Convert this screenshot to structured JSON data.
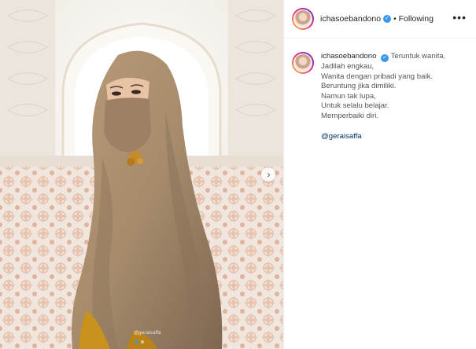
{
  "post": {
    "username": "ichasoebandono",
    "separator": "•",
    "follow_status": "Following",
    "more_label": "•••",
    "verified_mark": "✓",
    "caption": {
      "username": "ichasoebandono",
      "first_line": "Teruntuk wanita.",
      "lines": [
        "Jadilah engkau,",
        "Wanita dengan pribadi yang baik.",
        "Beruntung jika dimiliki.",
        "Namun tak lupa,",
        "Untuk selalu belajar.",
        "Memperbaiki diri."
      ],
      "mention": "@geraisaffa"
    }
  },
  "media": {
    "watermark": "@geraisaffa",
    "next_glyph": "›",
    "carousel_total": 2,
    "carousel_active": 1
  },
  "colors": {
    "verified": "#3897f0",
    "mention": "#003569",
    "hijab": "#a68b6c",
    "arch": "#f4efe8"
  }
}
